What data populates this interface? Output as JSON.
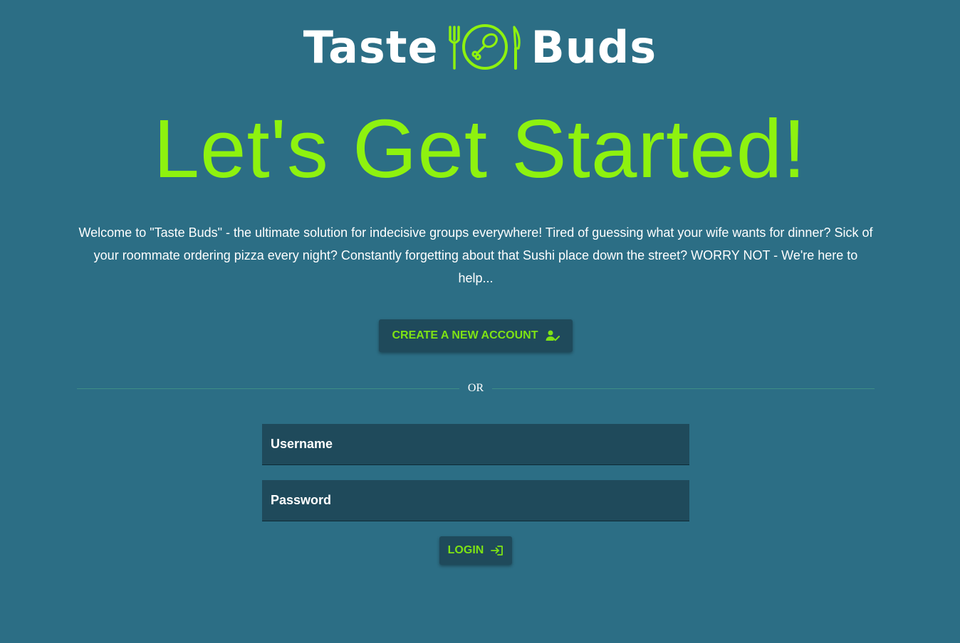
{
  "brand": {
    "word_left": "Taste",
    "word_right": "Buds",
    "logo_icon": "fork-plate-knife-icon",
    "accent_color": "#8ef20f"
  },
  "hero": {
    "headline": "Let's Get Started!",
    "intro": "Welcome to \"Taste Buds\" - the ultimate solution for indecisive groups everywhere! Tired of guessing what your wife wants for dinner? Sick of your roommate ordering pizza every night? Constantly forgetting about that Sushi place down the street? WORRY NOT - We're here to help..."
  },
  "actions": {
    "create_account_label": "CREATE A NEW ACCOUNT",
    "create_account_icon": "user-check-icon",
    "divider_label": "OR"
  },
  "login_form": {
    "username_placeholder": "Username",
    "password_placeholder": "Password",
    "login_label": "LOGIN",
    "login_icon": "login-arrow-icon"
  },
  "colors": {
    "background": "#2c6e85",
    "button_bg": "#1f4a5b",
    "button_text": "#7ee314"
  }
}
